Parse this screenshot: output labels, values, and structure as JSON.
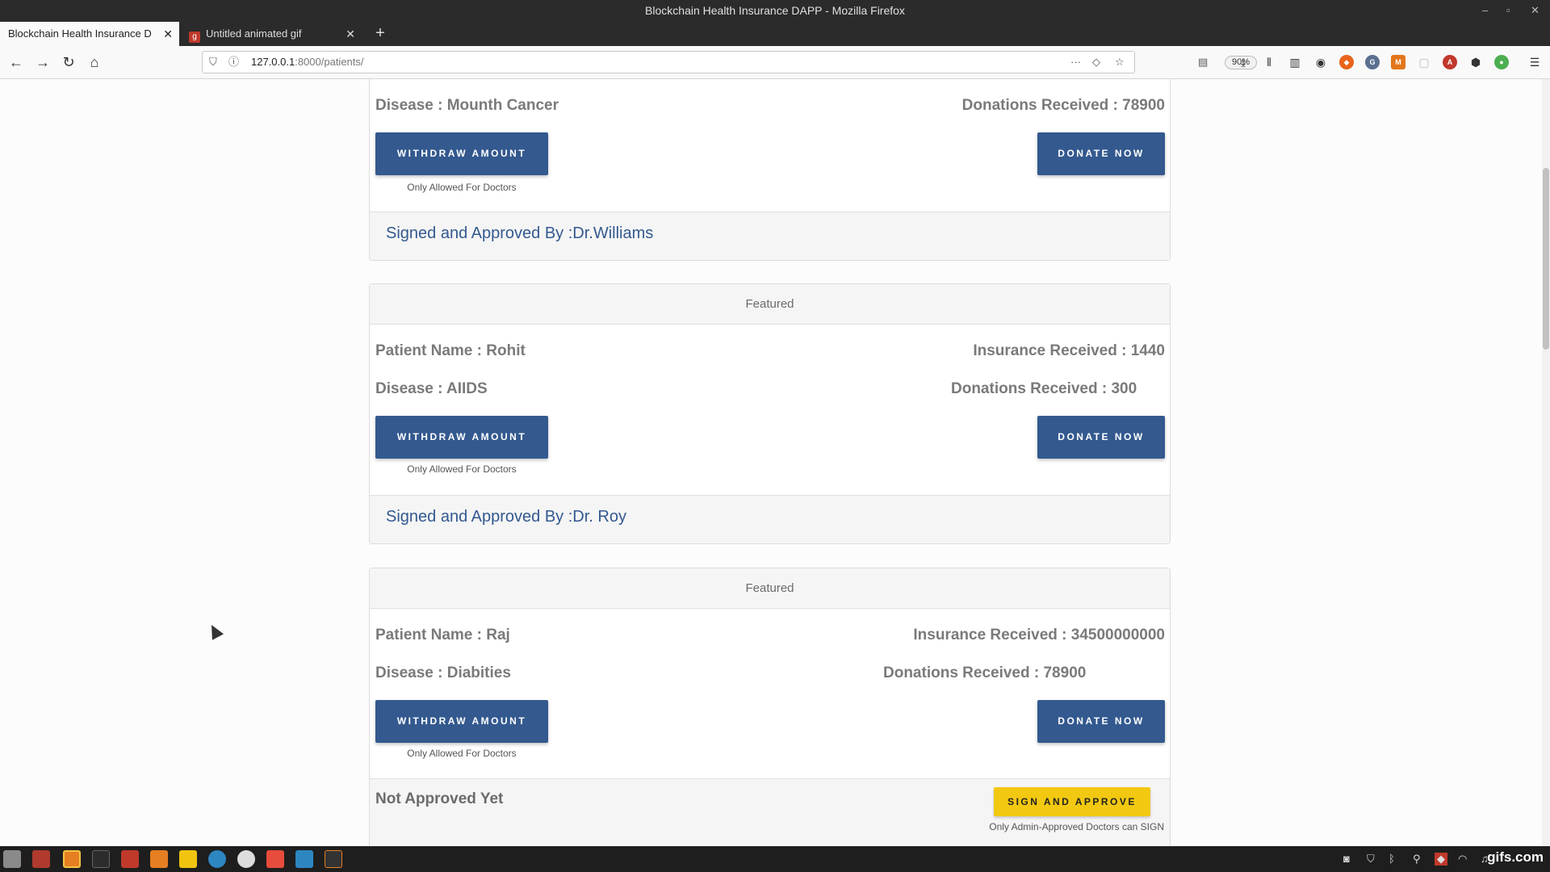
{
  "window": {
    "title": "Blockchain Health Insurance DAPP - Mozilla Firefox",
    "controls": [
      "–",
      "▫",
      "✕"
    ]
  },
  "tabs": [
    {
      "label": "Blockchain Health Insurance D"
    },
    {
      "label": "Untitled animated gif",
      "favicon": "g"
    }
  ],
  "toolbar": {
    "url_host": "127.0.0.1",
    "url_path": ":8000/patients/",
    "zoom": "90%"
  },
  "patients": [
    {
      "disease": "Disease : Mounth Cancer",
      "donations": "Donations Received : 78900",
      "withdraw_label": "WITHDRAW AMOUNT",
      "withdraw_note": "Only Allowed For Doctors",
      "donate_label": "DONATE NOW",
      "signed": "Signed and Approved By :Dr.Williams"
    },
    {
      "header": "Featured",
      "name": "Patient Name : Rohit",
      "insurance": "Insurance Received : 1440",
      "disease": "Disease : AIIDS",
      "donations": "Donations Received : 300",
      "withdraw_label": "WITHDRAW AMOUNT",
      "withdraw_note": "Only Allowed For Doctors",
      "donate_label": "DONATE NOW",
      "signed": "Signed and Approved By :Dr. Roy"
    },
    {
      "header": "Featured",
      "name": "Patient Name : Raj",
      "insurance": "Insurance Received : 34500000000",
      "disease": "Disease : Diabities",
      "donations": "Donations Received : 78900",
      "withdraw_label": "WITHDRAW AMOUNT",
      "withdraw_note": "Only Allowed For Doctors",
      "donate_label": "DONATE NOW",
      "status": "Not Approved Yet",
      "sign_label": "SIGN AND APPROVE",
      "sign_note": "Only Admin-Approved Doctors can SIGN"
    }
  ],
  "taskbar": {
    "watermark": "gifs.com"
  },
  "colors": {
    "primary_button": "#33598f",
    "sign_button": "#f2c811",
    "field_text": "#7a7a7a"
  }
}
